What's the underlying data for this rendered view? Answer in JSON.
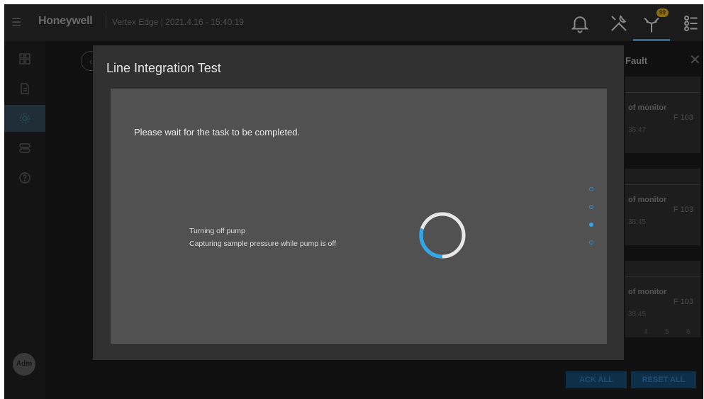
{
  "app": {
    "brand": "Honeywell",
    "version_line": "Vertex Edge | 2021.4.16 - 15:40:19",
    "notification_badge": "99"
  },
  "sidebar": {
    "avatar_label": "Adm",
    "items": [
      {
        "icon": "grid-icon"
      },
      {
        "icon": "document-icon"
      },
      {
        "icon": "settings-icon"
      },
      {
        "icon": "toggle-icon"
      },
      {
        "icon": "help-icon"
      }
    ]
  },
  "background": {
    "fault_title": "Fault",
    "fault_cards": [
      {
        "title": "of monitor",
        "code": "F 103",
        "time": "38:47"
      },
      {
        "title": "of monitor",
        "code": "F 103",
        "time": "38:45"
      },
      {
        "title": "of monitor",
        "code": "F 103",
        "time": "38:45"
      }
    ],
    "pages": [
      "4",
      "5",
      "6"
    ],
    "ack_all": "ACK ALL",
    "reset_all": "RESET ALL"
  },
  "modal": {
    "title": "Line Integration Test",
    "wait_message": "Please wait for the task to be completed.",
    "steps": [
      "Turning off pump",
      "Capturing sample pressure while pump is off"
    ],
    "progress_fraction": 0.3,
    "step_indicator": {
      "count": 4,
      "active_index": 2
    }
  },
  "colors": {
    "accent": "#2fa7ee",
    "modal_bg": "#303030",
    "body_bg": "#515151"
  }
}
